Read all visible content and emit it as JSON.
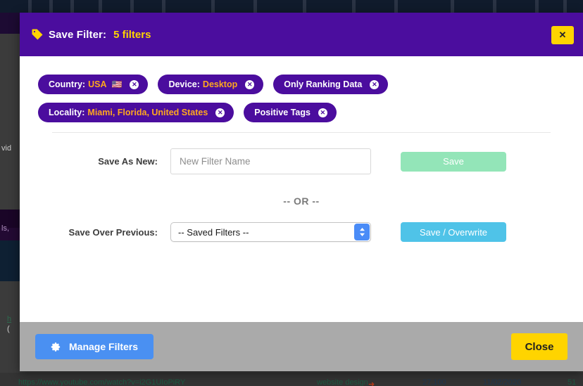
{
  "header": {
    "tag_icon": "tag-icon",
    "title": "Save Filter:",
    "count": "5 filters",
    "close_glyph": "✕"
  },
  "filters": {
    "rows": [
      [
        {
          "label": "Country:",
          "value": "USA",
          "flag": "🇺🇸",
          "remove_glyph": "✕"
        },
        {
          "label": "Device:",
          "value": "Desktop",
          "flag": "",
          "remove_glyph": "✕"
        },
        {
          "label": "Only Ranking Data",
          "value": "",
          "flag": "",
          "remove_glyph": "✕"
        }
      ],
      [
        {
          "label": "Locality:",
          "value": "Miami, Florida, United States",
          "flag": "",
          "remove_glyph": "✕"
        },
        {
          "label": "Positive Tags",
          "value": "",
          "flag": "",
          "remove_glyph": "✕"
        }
      ]
    ]
  },
  "form": {
    "save_as_new_label": "Save As New:",
    "new_filter_placeholder": "New Filter Name",
    "new_filter_value": "",
    "save_button": "Save",
    "or_text": "-- OR --",
    "save_over_previous_label": "Save Over Previous:",
    "saved_filters_selected": "-- Saved Filters --",
    "saved_filters_options": [
      "-- Saved Filters --"
    ],
    "save_overwrite_button": "Save / Overwrite"
  },
  "footer": {
    "manage_filters_label": "Manage Filters",
    "gear_icon": "gear-icon",
    "close_label": "Close"
  },
  "background": {
    "video_text": "vid",
    "locality_text": "ls,",
    "link_text": "h",
    "link_text2": "(",
    "bottom_row": {
      "url": "https://www.youtube.com/watch?v=i2G1UIoPiRY",
      "keyword": "website design",
      "volume": "27,100",
      "date": "11/02/2020",
      "position": "51",
      "arrow": "➜"
    }
  },
  "colors": {
    "modal_header_purple": "#4b0d9e",
    "accent_yellow": "#ffd400",
    "pill_value_orange": "#ffa81e",
    "save_green": "#93e5b8",
    "overwrite_cyan": "#4fc3e8",
    "manage_blue": "#4a90f2",
    "footer_gray": "#aaaaaa"
  }
}
